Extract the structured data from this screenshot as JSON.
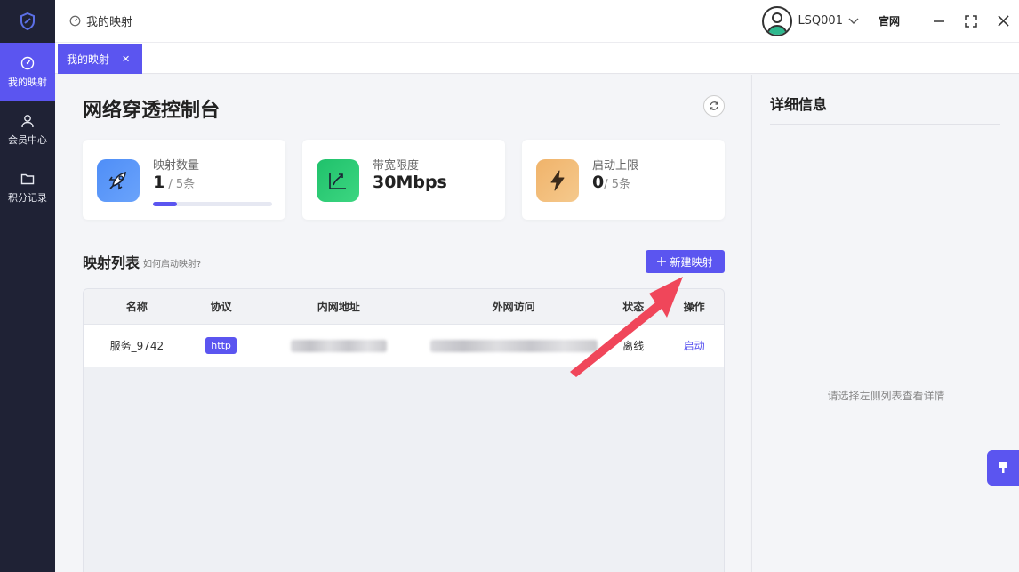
{
  "sidebar": {
    "logo_icon": "shield-icon",
    "items": [
      {
        "label": "我的映射",
        "icon": "gauge-icon",
        "active": true
      },
      {
        "label": "会员中心",
        "icon": "user-icon",
        "active": false
      },
      {
        "label": "积分记录",
        "icon": "folder-icon",
        "active": false
      }
    ]
  },
  "topbar": {
    "breadcrumb": "我的映射",
    "username": "LSQ001",
    "official_link": "官网"
  },
  "tabs": [
    {
      "label": "我的映射",
      "close": "✕"
    }
  ],
  "main": {
    "title": "网络穿透控制台",
    "cards": [
      {
        "label": "映射数量",
        "value": "1",
        "of": " / 5条",
        "progress": 0.2,
        "color_from": "#4f8ef7",
        "color_to": "#6aa3fb"
      },
      {
        "label": "带宽限度",
        "value": "30Mbps",
        "of": "",
        "color_from": "#1fc16b",
        "color_to": "#3dd681"
      },
      {
        "label": "启动上限",
        "value": "0",
        "of": "/ 5条",
        "color_from": "#f0b36a",
        "color_to": "#f5c98d"
      }
    ],
    "list_title": "映射列表",
    "list_hint": "如何启动映射?",
    "new_button": "新建映射",
    "table": {
      "headers": [
        "名称",
        "协议",
        "内网地址",
        "外网访问",
        "状态",
        "操作"
      ],
      "rows": [
        {
          "name": "服务_9742",
          "protocol": "http",
          "status": "离线",
          "action": "启动"
        }
      ]
    }
  },
  "detail": {
    "title": "详细信息",
    "empty_text": "请选择左侧列表查看详情"
  },
  "colors": {
    "accent": "#5b55f0",
    "sidebar_bg": "#1f2235",
    "annotation_arrow": "#f0465a"
  }
}
